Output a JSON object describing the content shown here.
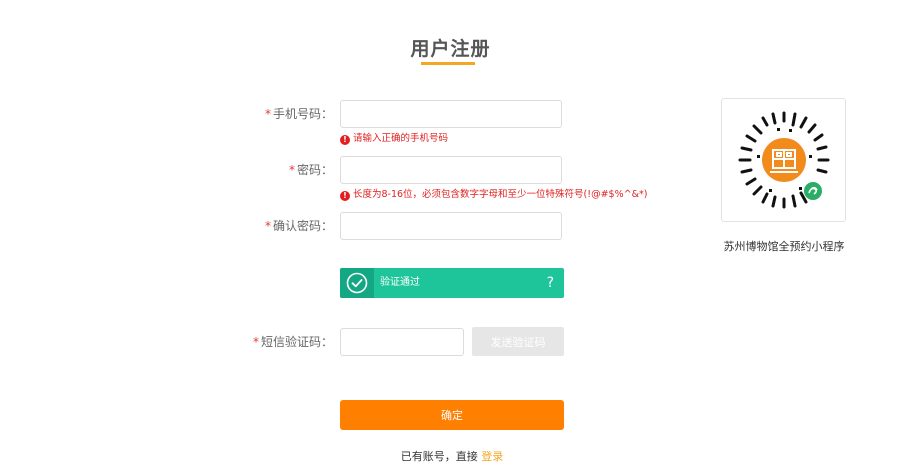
{
  "header": {
    "title": "用户注册",
    "accent_color": "#f5a623"
  },
  "form": {
    "required_mark": "*",
    "phone": {
      "label": "手机号码：",
      "value": "",
      "error": "请输入正确的手机号码"
    },
    "password": {
      "label": "密码：",
      "value": "",
      "error": "长度为8-16位，必须包含数字字母和至少一位特殊符号(!@#$%^&*)"
    },
    "confirm_password": {
      "label": "确认密码：",
      "value": ""
    },
    "captcha": {
      "status_text": "验证通过",
      "help_icon": "?",
      "color": "#1fc59a",
      "handle_icon": "check-circle-icon"
    },
    "sms_code": {
      "label": "短信验证码：",
      "value": "",
      "send_button": "发送验证码"
    },
    "submit_label": "确定",
    "submit_color": "#ff7f00"
  },
  "footer": {
    "text": "已有账号，直接",
    "login_link": "登录"
  },
  "sidebar": {
    "qr_caption": "苏州博物馆全预约小程序",
    "qr_icon": "wechat-miniprogram-qr-code"
  }
}
